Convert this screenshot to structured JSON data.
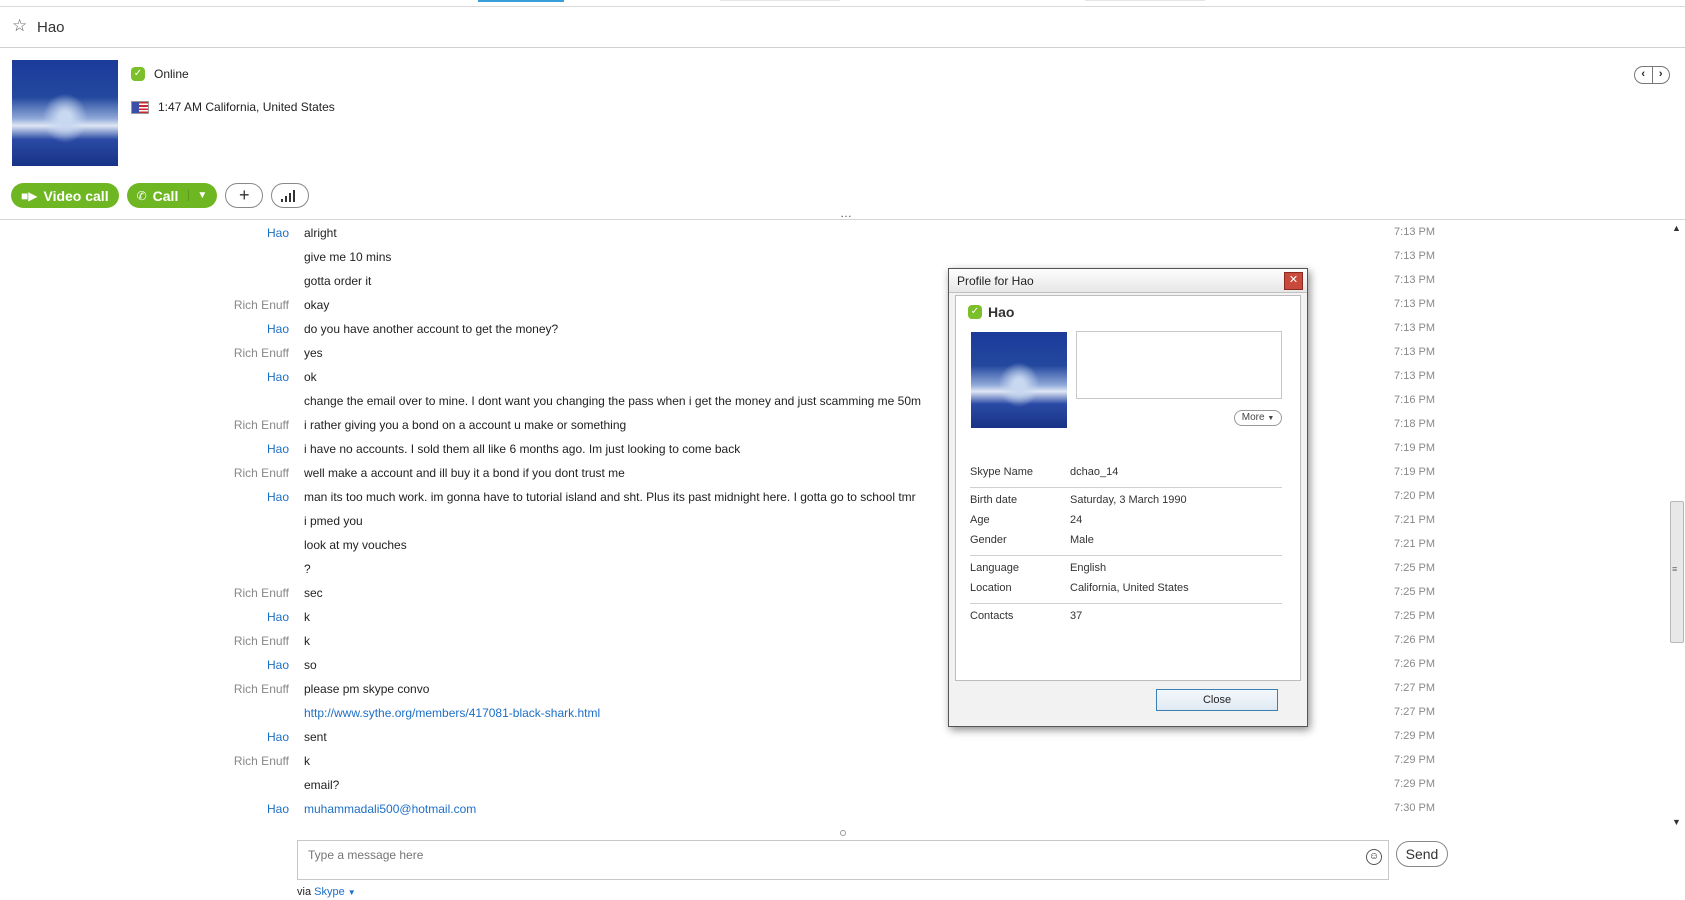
{
  "header": {
    "contact_name": "Hao"
  },
  "contact": {
    "status": "Online",
    "local_time": "1:47 AM California, United States"
  },
  "actions": {
    "video_call": "Video call",
    "call": "Call",
    "add_icon": "plus-icon",
    "signal_icon": "signal-bars-icon"
  },
  "messages": [
    {
      "who": "Hao",
      "text": "alright",
      "time": "7:13 PM"
    },
    {
      "who": "",
      "text": "give me 10 mins",
      "time": "7:13 PM"
    },
    {
      "who": "",
      "text": "gotta order it",
      "time": "7:13 PM"
    },
    {
      "who": "Rich Enuff",
      "text": "okay",
      "time": "7:13 PM"
    },
    {
      "who": "Hao",
      "text": "do you have another account to get the money?",
      "time": "7:13 PM"
    },
    {
      "who": "Rich Enuff",
      "text": "yes",
      "time": "7:13 PM"
    },
    {
      "who": "Hao",
      "text": "ok",
      "time": "7:13 PM"
    },
    {
      "who": "",
      "text": "change the email over to mine. I dont want you changing the pass when i get the money and just scamming me 50m",
      "time": "7:16 PM"
    },
    {
      "who": "Rich Enuff",
      "text": "i rather giving you a bond on a account u make or something",
      "time": "7:18 PM"
    },
    {
      "who": "Hao",
      "text": "i have no accounts. I sold them all like 6 months ago. Im just looking to come back",
      "time": "7:19 PM"
    },
    {
      "who": "Rich Enuff",
      "text": "well make a account and ill buy it a bond if you dont trust me",
      "time": "7:19 PM"
    },
    {
      "who": "Hao",
      "text": "man its too much work. im gonna have to tutorial island and sht. Plus its past midnight here. I gotta go to school tmr",
      "time": "7:20 PM"
    },
    {
      "who": "",
      "text": "i pmed you",
      "time": "7:21 PM"
    },
    {
      "who": "",
      "text": "look at my vouches",
      "time": "7:21 PM"
    },
    {
      "who": "",
      "text": "?",
      "time": "7:25 PM"
    },
    {
      "who": "Rich Enuff",
      "text": "sec",
      "time": "7:25 PM"
    },
    {
      "who": "Hao",
      "text": "k",
      "time": "7:25 PM"
    },
    {
      "who": "Rich Enuff",
      "text": "k",
      "time": "7:26 PM"
    },
    {
      "who": "Hao",
      "text": "so",
      "time": "7:26 PM"
    },
    {
      "who": "Rich Enuff",
      "text": "please pm skype convo",
      "time": "7:27 PM"
    },
    {
      "who": "",
      "text": "http://www.sythe.org/members/417081-black-shark.html",
      "time": "7:27 PM",
      "link": true
    },
    {
      "who": "Hao",
      "text": "sent",
      "time": "7:29 PM"
    },
    {
      "who": "Rich Enuff",
      "text": "k",
      "time": "7:29 PM"
    },
    {
      "who": "",
      "text": "email?",
      "time": "7:29 PM"
    },
    {
      "who": "Hao",
      "text": "muhammadali500@hotmail.com",
      "time": "7:30 PM",
      "link": true
    }
  ],
  "compose": {
    "placeholder": "Type a message here",
    "send_label": "Send"
  },
  "via": {
    "prefix": "via",
    "service": "Skype"
  },
  "profile_dialog": {
    "title": "Profile for Hao",
    "name": "Hao",
    "more_label": "More",
    "close_label": "Close",
    "fields": {
      "skype_name": {
        "k": "Skype Name",
        "v": "dchao_14"
      },
      "birth_date": {
        "k": "Birth date",
        "v": "Saturday, 3 March 1990"
      },
      "age": {
        "k": "Age",
        "v": "24"
      },
      "gender": {
        "k": "Gender",
        "v": "Male"
      },
      "language": {
        "k": "Language",
        "v": "English"
      },
      "location": {
        "k": "Location",
        "v": "California, United States"
      },
      "contacts": {
        "k": "Contacts",
        "v": "37"
      }
    }
  }
}
